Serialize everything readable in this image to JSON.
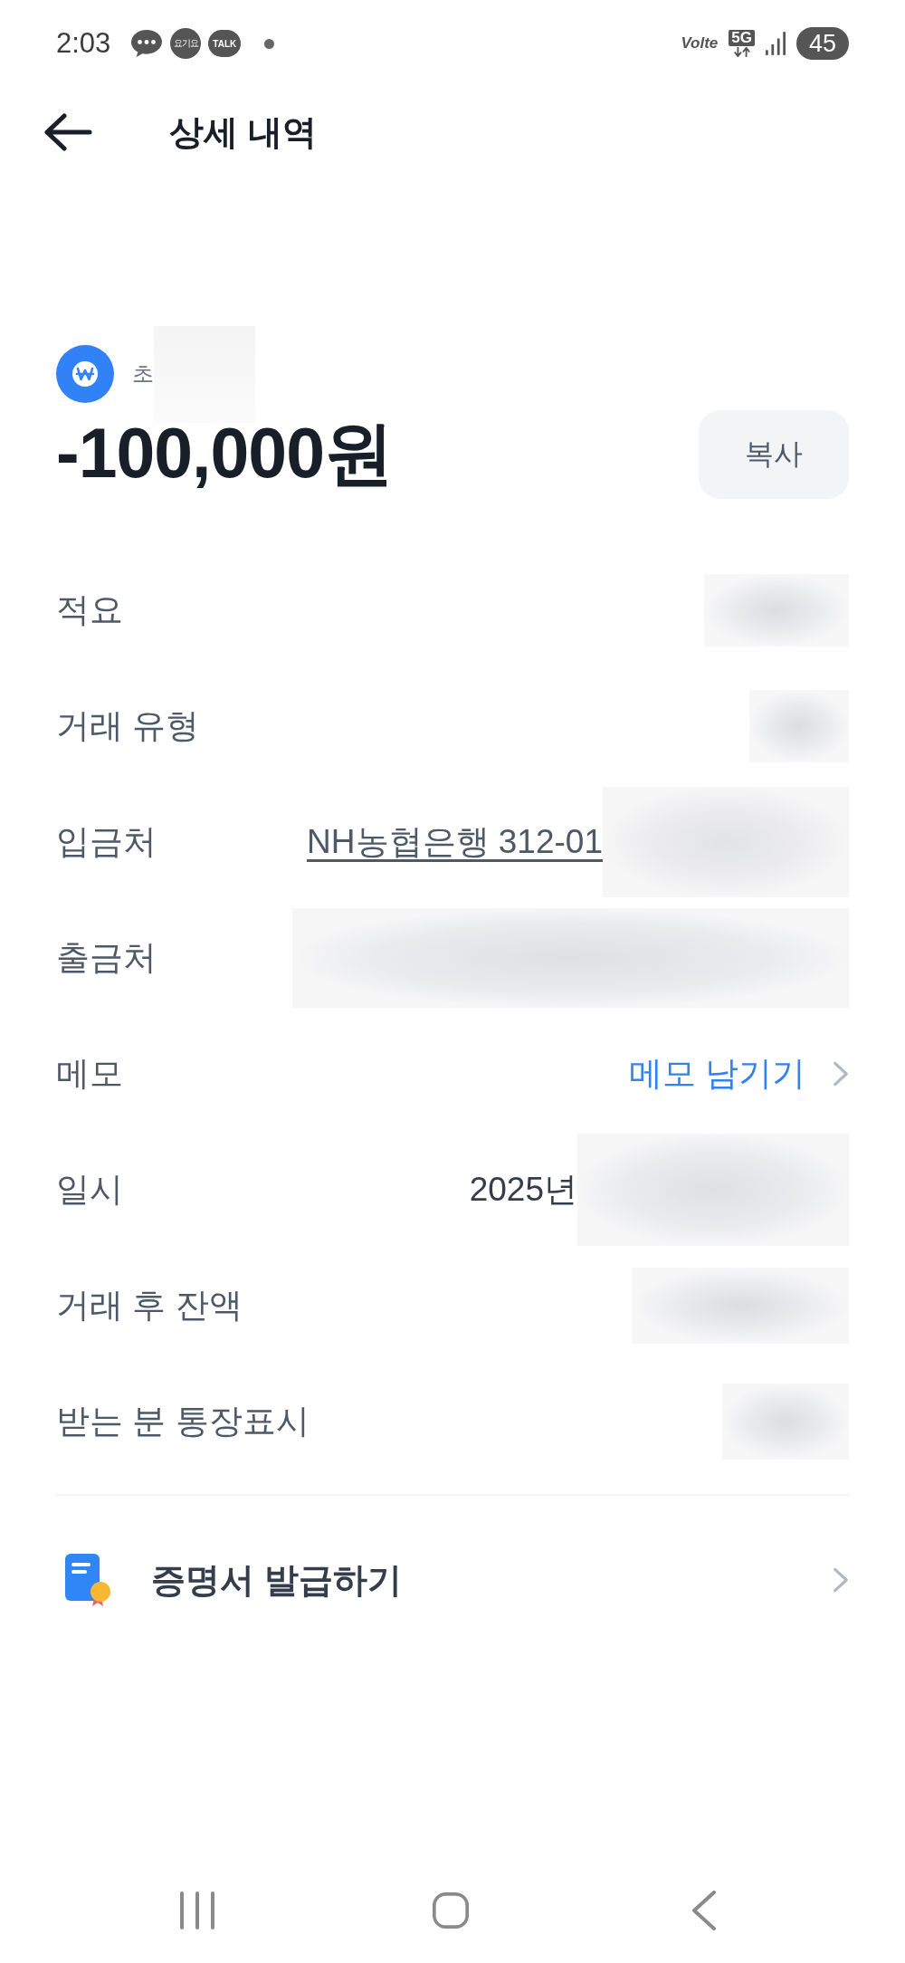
{
  "status_bar": {
    "time": "2:03",
    "notifications": [
      {
        "kind": "chat"
      },
      {
        "kind": "app",
        "label": "요기요"
      },
      {
        "kind": "talk",
        "label": "TALK"
      },
      {
        "kind": "dot"
      }
    ],
    "volte": "Volte",
    "network": "5G",
    "battery": "45"
  },
  "header": {
    "title": "상세 내역"
  },
  "account": {
    "name": "초",
    "redacted": true
  },
  "amount": "-100,000원",
  "copy_button": {
    "label": "복사"
  },
  "details": [
    {
      "label": "적요",
      "redacted": true
    },
    {
      "label": "거래 유형",
      "redacted": true
    },
    {
      "label": "입금처",
      "kind": "link",
      "value": "NH농협은행 312-01",
      "redacted": true
    },
    {
      "label": "출금처",
      "redacted": true
    },
    {
      "label": "메모",
      "kind": "action",
      "value": "메모 남기기",
      "redacted": false
    },
    {
      "label": "일시",
      "kind": "text",
      "value": "2025년",
      "redacted": true
    },
    {
      "label": "거래 후 잔액",
      "redacted": true
    },
    {
      "label": "받는 분 통장표시",
      "redacted": true
    }
  ],
  "certificate": {
    "label": "증명서 발급하기"
  }
}
